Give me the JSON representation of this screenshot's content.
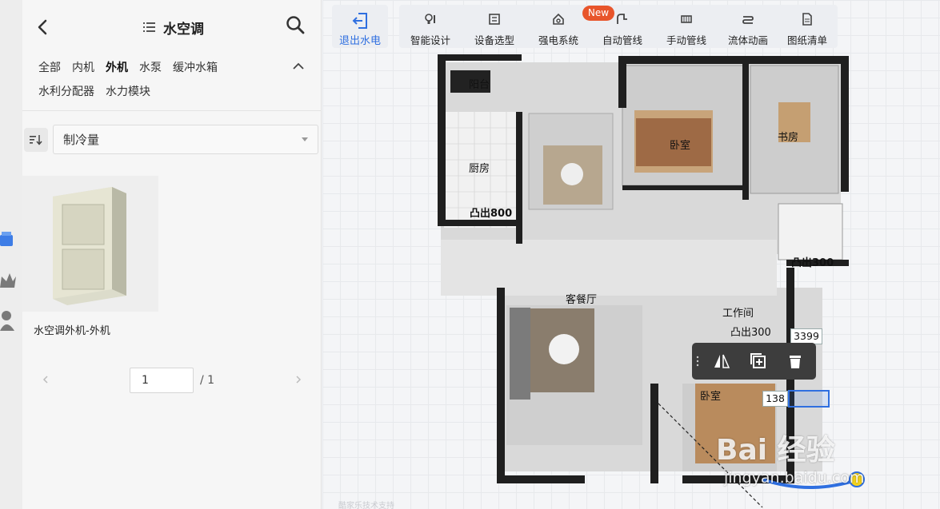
{
  "panel": {
    "title": "水空调",
    "categories_row1": [
      "全部",
      "内机",
      "外机",
      "水泵",
      "缓冲水箱"
    ],
    "categories_row2": [
      "水利分配器",
      "水力模块"
    ],
    "active_category": "外机",
    "sort": {
      "selected": "制冷量"
    },
    "product": {
      "name": "水空调外机-外机"
    },
    "pager": {
      "current": "1",
      "total": "/ 1"
    }
  },
  "toolbar": {
    "exit_label": "退出水电",
    "new_badge": "New",
    "tools": [
      {
        "label": "智能设计",
        "icon": "bulb-icon"
      },
      {
        "label": "设备选型",
        "icon": "device-icon"
      },
      {
        "label": "强电系统",
        "icon": "power-icon"
      },
      {
        "label": "自动管线",
        "icon": "auto-pipe-icon"
      },
      {
        "label": "手动管线",
        "icon": "manual-pipe-icon"
      },
      {
        "label": "流体动画",
        "icon": "fluid-icon"
      },
      {
        "label": "图纸清单",
        "icon": "drawing-list-icon"
      }
    ]
  },
  "floorplan": {
    "rooms": {
      "balcony": "阳台",
      "kitchen": "厨房",
      "kitchen_bay": "凸出800",
      "bedroom_main": "卧室",
      "study": "书房",
      "bath_bay": "凸出300",
      "living": "客餐厅",
      "utility": "工作间",
      "utility_bay": "凸出300",
      "bedroom_small": "卧室"
    },
    "dimensions": {
      "d1": "3399",
      "d2": "138"
    }
  },
  "watermark": {
    "brand": "Bai 经验",
    "url": "jingyan.baidu.com"
  },
  "footer_note": "酷家乐技术支持",
  "colors": {
    "accent": "#2f6fe0",
    "badge": "#e8552b",
    "wall": "#1f1f1f"
  }
}
